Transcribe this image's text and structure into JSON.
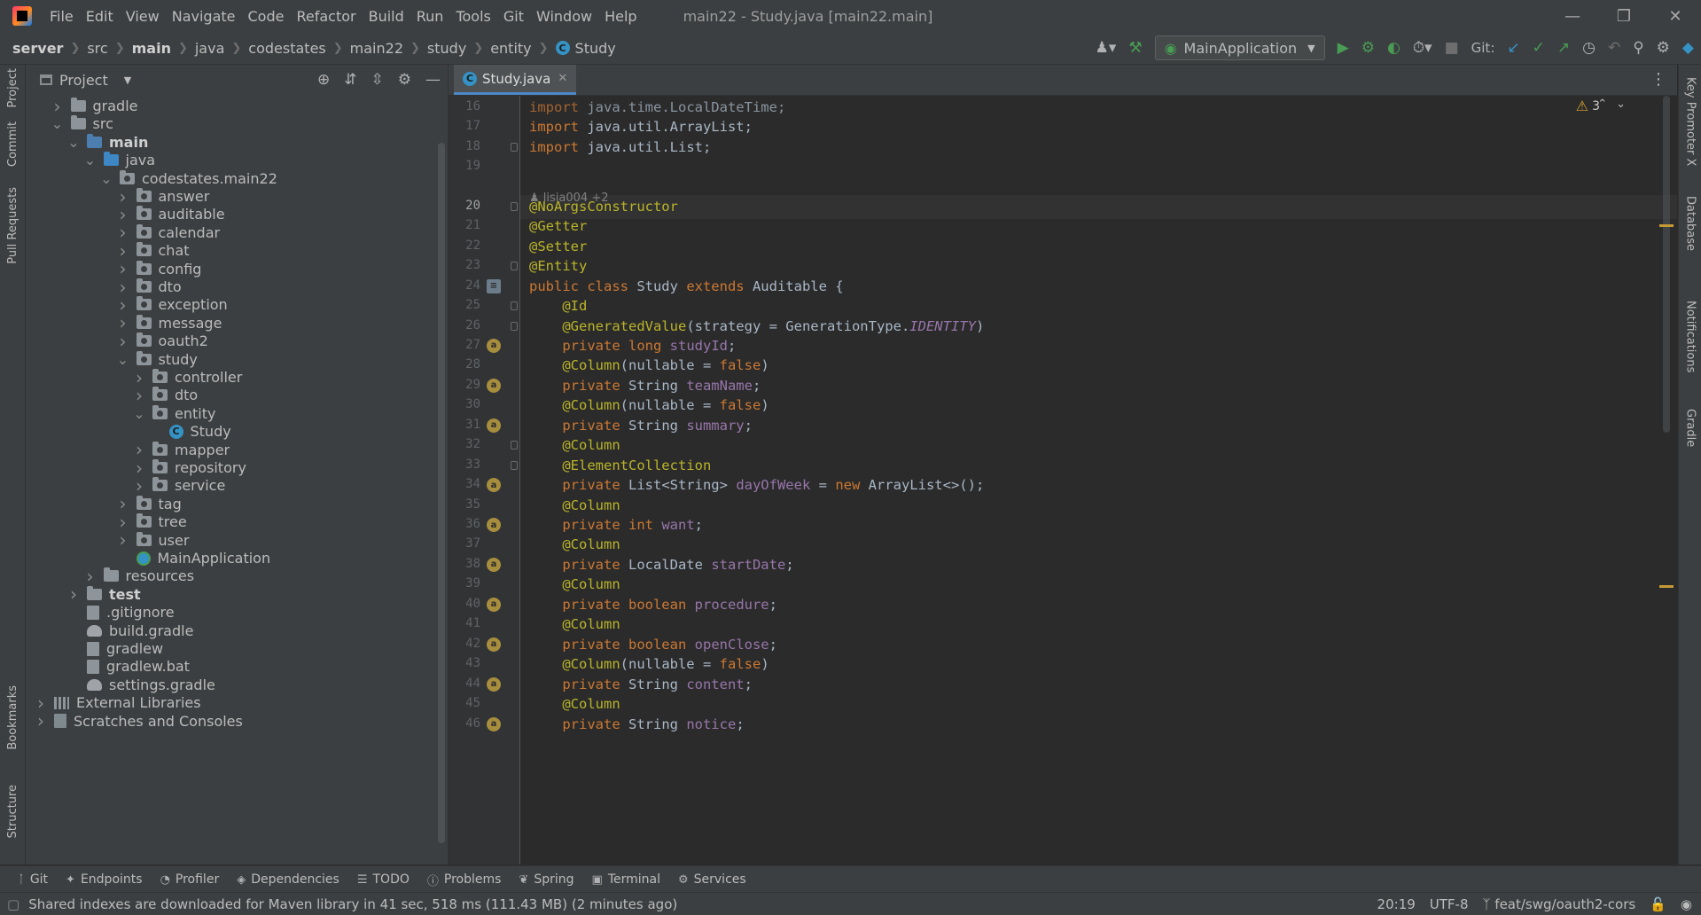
{
  "menubar": {
    "items": [
      "File",
      "Edit",
      "View",
      "Navigate",
      "Code",
      "Refactor",
      "Build",
      "Run",
      "Tools",
      "Git",
      "Window",
      "Help"
    ],
    "window_title": "main22 - Study.java [main22.main]"
  },
  "breadcrumb": [
    "server",
    "src",
    "main",
    "java",
    "codestates",
    "main22",
    "study",
    "entity",
    "Study"
  ],
  "toolbar": {
    "run_config": "MainApplication",
    "git_label": "Git:"
  },
  "left_strip": [
    "Project",
    "Commit",
    "Pull Requests",
    "Bookmarks",
    "Structure"
  ],
  "right_strip": [
    "Key Promoter X",
    "Database",
    "Notifications",
    "Gradle"
  ],
  "project_panel": {
    "title": "Project",
    "tree": [
      {
        "label": "gradle",
        "icon": "folder",
        "depth": 1,
        "arrow": "right",
        "bold": false
      },
      {
        "label": "src",
        "icon": "folder",
        "depth": 1,
        "arrow": "down",
        "bold": false
      },
      {
        "label": "main",
        "icon": "folder-src",
        "depth": 2,
        "arrow": "down",
        "bold": true
      },
      {
        "label": "java",
        "icon": "folder-java",
        "depth": 3,
        "arrow": "down",
        "bold": false
      },
      {
        "label": "codestates.main22",
        "icon": "package",
        "depth": 4,
        "arrow": "down",
        "bold": false
      },
      {
        "label": "answer",
        "icon": "package",
        "depth": 5,
        "arrow": "right",
        "bold": false
      },
      {
        "label": "auditable",
        "icon": "package",
        "depth": 5,
        "arrow": "right",
        "bold": false
      },
      {
        "label": "calendar",
        "icon": "package",
        "depth": 5,
        "arrow": "right",
        "bold": false
      },
      {
        "label": "chat",
        "icon": "package",
        "depth": 5,
        "arrow": "right",
        "bold": false
      },
      {
        "label": "config",
        "icon": "package",
        "depth": 5,
        "arrow": "right",
        "bold": false
      },
      {
        "label": "dto",
        "icon": "package",
        "depth": 5,
        "arrow": "right",
        "bold": false
      },
      {
        "label": "exception",
        "icon": "package",
        "depth": 5,
        "arrow": "right",
        "bold": false
      },
      {
        "label": "message",
        "icon": "package",
        "depth": 5,
        "arrow": "right",
        "bold": false
      },
      {
        "label": "oauth2",
        "icon": "package",
        "depth": 5,
        "arrow": "right",
        "bold": false
      },
      {
        "label": "study",
        "icon": "package",
        "depth": 5,
        "arrow": "down",
        "bold": false
      },
      {
        "label": "controller",
        "icon": "package",
        "depth": 6,
        "arrow": "right",
        "bold": false
      },
      {
        "label": "dto",
        "icon": "package",
        "depth": 6,
        "arrow": "right",
        "bold": false
      },
      {
        "label": "entity",
        "icon": "package",
        "depth": 6,
        "arrow": "down",
        "bold": false
      },
      {
        "label": "Study",
        "icon": "class",
        "depth": 7,
        "arrow": "",
        "bold": false
      },
      {
        "label": "mapper",
        "icon": "package",
        "depth": 6,
        "arrow": "right",
        "bold": false
      },
      {
        "label": "repository",
        "icon": "package",
        "depth": 6,
        "arrow": "right",
        "bold": false
      },
      {
        "label": "service",
        "icon": "package",
        "depth": 6,
        "arrow": "right",
        "bold": false
      },
      {
        "label": "tag",
        "icon": "package",
        "depth": 5,
        "arrow": "right",
        "bold": false
      },
      {
        "label": "tree",
        "icon": "package",
        "depth": 5,
        "arrow": "right",
        "bold": false
      },
      {
        "label": "user",
        "icon": "package",
        "depth": 5,
        "arrow": "right",
        "bold": false
      },
      {
        "label": "MainApplication",
        "icon": "app",
        "depth": 5,
        "arrow": "",
        "bold": false
      },
      {
        "label": "resources",
        "icon": "folder",
        "depth": 3,
        "arrow": "right",
        "bold": false
      },
      {
        "label": "test",
        "icon": "folder",
        "depth": 2,
        "arrow": "right",
        "bold": true
      },
      {
        "label": ".gitignore",
        "icon": "file",
        "depth": 2,
        "arrow": "",
        "bold": false
      },
      {
        "label": "build.gradle",
        "icon": "gradle",
        "depth": 2,
        "arrow": "",
        "bold": false
      },
      {
        "label": "gradlew",
        "icon": "file",
        "depth": 2,
        "arrow": "",
        "bold": false
      },
      {
        "label": "gradlew.bat",
        "icon": "file",
        "depth": 2,
        "arrow": "",
        "bold": false
      },
      {
        "label": "settings.gradle",
        "icon": "gradle",
        "depth": 2,
        "arrow": "",
        "bold": false
      },
      {
        "label": "External Libraries",
        "icon": "library",
        "depth": 0,
        "arrow": "right",
        "bold": false
      },
      {
        "label": "Scratches and Consoles",
        "icon": "scratch",
        "depth": 0,
        "arrow": "right",
        "bold": false
      }
    ]
  },
  "editor": {
    "tab_label": "Study.java",
    "author_hint": "lisia004 +2",
    "warnings_count": "3",
    "current_line": 20,
    "lines": [
      {
        "n": 16,
        "html": "<span class=\"kw\">import</span> java.time.LocalDateTime;",
        "mark": "",
        "fold": false
      },
      {
        "n": 17,
        "html": "<span class=\"kw\">import</span> java.util.ArrayList;",
        "mark": "",
        "fold": false
      },
      {
        "n": 18,
        "html": "<span class=\"kw\">import</span> java.util.List;",
        "mark": "",
        "fold": true
      },
      {
        "n": 19,
        "html": "",
        "mark": "",
        "fold": false
      },
      {
        "n": 20,
        "html": "<span class=\"an\">@NoArgsConstructor</span>",
        "mark": "",
        "fold": true
      },
      {
        "n": 21,
        "html": "<span class=\"an\">@Getter</span>",
        "mark": "",
        "fold": false
      },
      {
        "n": 22,
        "html": "<span class=\"an\">@Setter</span>",
        "mark": "",
        "fold": false
      },
      {
        "n": 23,
        "html": "<span class=\"an\">@Entity</span>",
        "mark": "",
        "fold": true
      },
      {
        "n": 24,
        "html": "<span class=\"kw\">public class</span> Study <span class=\"kw\">extends</span> Auditable {",
        "mark": "db",
        "fold": false
      },
      {
        "n": 25,
        "html": "    <span class=\"an\">@Id</span>",
        "mark": "",
        "fold": true
      },
      {
        "n": 26,
        "html": "    <span class=\"an\">@GeneratedValue</span>(strategy = GenerationType.<span class=\"st\">IDENTITY</span>)",
        "mark": "",
        "fold": true
      },
      {
        "n": 27,
        "html": "    <span class=\"kw\">private long</span> <span class=\"fd\">studyId</span>;",
        "mark": "key",
        "fold": false
      },
      {
        "n": 28,
        "html": "    <span class=\"an\">@Column</span>(nullable = <span class=\"kw\">false</span>)",
        "mark": "",
        "fold": false
      },
      {
        "n": 29,
        "html": "    <span class=\"kw\">private</span> String <span class=\"fd\">teamName</span>;",
        "mark": "a",
        "fold": false
      },
      {
        "n": 30,
        "html": "    <span class=\"an\">@Column</span>(nullable = <span class=\"kw\">false</span>)",
        "mark": "",
        "fold": false
      },
      {
        "n": 31,
        "html": "    <span class=\"kw\">private</span> String <span class=\"fd\">summary</span>;",
        "mark": "a",
        "fold": false
      },
      {
        "n": 32,
        "html": "    <span class=\"an\">@Column</span>",
        "mark": "",
        "fold": true
      },
      {
        "n": 33,
        "html": "    <span class=\"an\">@ElementCollection</span>",
        "mark": "",
        "fold": true
      },
      {
        "n": 34,
        "html": "    <span class=\"kw\">private</span> List&lt;String&gt; <span class=\"fd\">dayOfWeek</span> = <span class=\"kw\">new</span> ArrayList&lt;&gt;();",
        "mark": "a",
        "fold": false
      },
      {
        "n": 35,
        "html": "    <span class=\"an\">@Column</span>",
        "mark": "",
        "fold": false
      },
      {
        "n": 36,
        "html": "    <span class=\"kw\">private int</span> <span class=\"fd\">want</span>;",
        "mark": "a",
        "fold": false
      },
      {
        "n": 37,
        "html": "    <span class=\"an\">@Column</span>",
        "mark": "",
        "fold": false
      },
      {
        "n": 38,
        "html": "    <span class=\"kw\">private</span> LocalDate <span class=\"fd\">startDate</span>;",
        "mark": "a",
        "fold": false
      },
      {
        "n": 39,
        "html": "    <span class=\"an\">@Column</span>",
        "mark": "",
        "fold": false
      },
      {
        "n": 40,
        "html": "    <span class=\"kw\">private boolean</span> <span class=\"fd\">procedure</span>;",
        "mark": "a",
        "fold": false
      },
      {
        "n": 41,
        "html": "    <span class=\"an\">@Column</span>",
        "mark": "",
        "fold": false
      },
      {
        "n": 42,
        "html": "    <span class=\"kw\">private boolean</span> <span class=\"fd\">openClose</span>;",
        "mark": "a",
        "fold": false
      },
      {
        "n": 43,
        "html": "    <span class=\"an\">@Column</span>(nullable = <span class=\"kw\">false</span>)",
        "mark": "",
        "fold": false
      },
      {
        "n": 44,
        "html": "    <span class=\"kw\">private</span> String <span class=\"fd\">content</span>;",
        "mark": "a",
        "fold": false
      },
      {
        "n": 45,
        "html": "    <span class=\"an\">@Column</span>",
        "mark": "",
        "fold": false
      },
      {
        "n": 46,
        "html": "    <span class=\"kw\">private</span> String <span class=\"fd\">notice</span>;",
        "mark": "a",
        "fold": false
      }
    ]
  },
  "bottom_bar": [
    {
      "label": "Git",
      "icon": "git-branch-icon"
    },
    {
      "label": "Endpoints",
      "icon": "endpoints-icon"
    },
    {
      "label": "Profiler",
      "icon": "profiler-icon"
    },
    {
      "label": "Dependencies",
      "icon": "dependencies-icon"
    },
    {
      "label": "TODO",
      "icon": "todo-icon"
    },
    {
      "label": "Problems",
      "icon": "problems-icon"
    },
    {
      "label": "Spring",
      "icon": "spring-icon"
    },
    {
      "label": "Terminal",
      "icon": "terminal-icon"
    },
    {
      "label": "Services",
      "icon": "services-icon"
    }
  ],
  "status_bar": {
    "message": "Shared indexes are downloaded for Maven library in 41 sec, 518 ms (111.43 MB) (2 minutes ago)",
    "position": "20:19",
    "encoding": "UTF-8",
    "branch": "feat/swg/oauth2-cors"
  }
}
